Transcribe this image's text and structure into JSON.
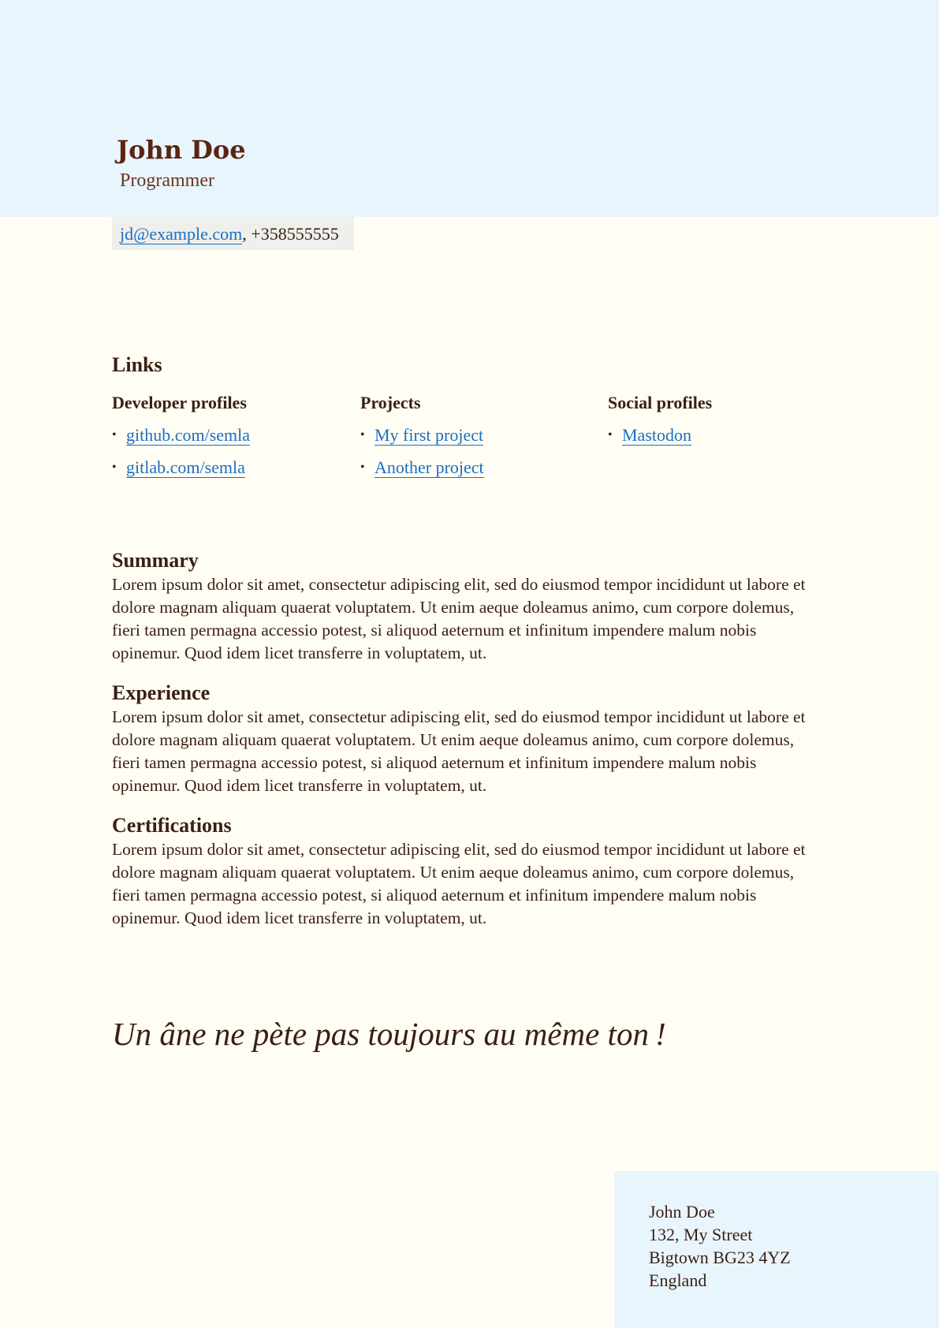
{
  "header": {
    "name": "John Doe",
    "role": "Programmer",
    "email": "jd@example.com",
    "separator": ", ",
    "phone": "+358555555"
  },
  "links": {
    "title": "Links",
    "columns": [
      {
        "title": "Developer profiles",
        "items": [
          "github.com/semla",
          "gitlab.com/semla"
        ]
      },
      {
        "title": "Projects",
        "items": [
          "My first project",
          "Another project"
        ]
      },
      {
        "title": "Social profiles",
        "items": [
          "Mastodon"
        ]
      }
    ]
  },
  "sections": [
    {
      "title": "Summary",
      "body": "Lorem ipsum dolor sit amet, consectetur adipiscing elit, sed do eiusmod tempor incididunt ut labore et dolore magnam aliquam quaerat voluptatem. Ut enim aeque doleamus animo, cum corpore dolemus, fieri tamen permagna accessio potest, si aliquod aeternum et infinitum impendere malum nobis opinemur. Quod idem licet transferre in voluptatem, ut."
    },
    {
      "title": "Experience",
      "body": "Lorem ipsum dolor sit amet, consectetur adipiscing elit, sed do eiusmod tempor incididunt ut labore et dolore magnam aliquam quaerat voluptatem. Ut enim aeque doleamus animo, cum corpore dolemus, fieri tamen permagna accessio potest, si aliquod aeternum et infinitum impendere malum nobis opinemur. Quod idem licet transferre in voluptatem, ut."
    },
    {
      "title": "Certifications",
      "body": "Lorem ipsum dolor sit amet, consectetur adipiscing elit, sed do eiusmod tempor incididunt ut labore et dolore magnam aliquam quaerat voluptatem. Ut enim aeque doleamus animo, cum corpore dolemus, fieri tamen permagna accessio potest, si aliquod aeternum et infinitum impendere malum nobis opinemur. Quod idem licet transferre in voluptatem, ut."
    }
  ],
  "quote": "Un âne ne pète pas toujours au même ton !",
  "address": {
    "lines": [
      "John Doe",
      "132, My Street",
      "Bigtown BG23 4YZ",
      "England"
    ]
  },
  "colors": {
    "header_band": "#e8f5fd",
    "page_background": "#fffdf4",
    "name": "#5b2412",
    "text": "#3a1f12",
    "link": "#1a6fc4",
    "contact_background": "#efefec"
  }
}
